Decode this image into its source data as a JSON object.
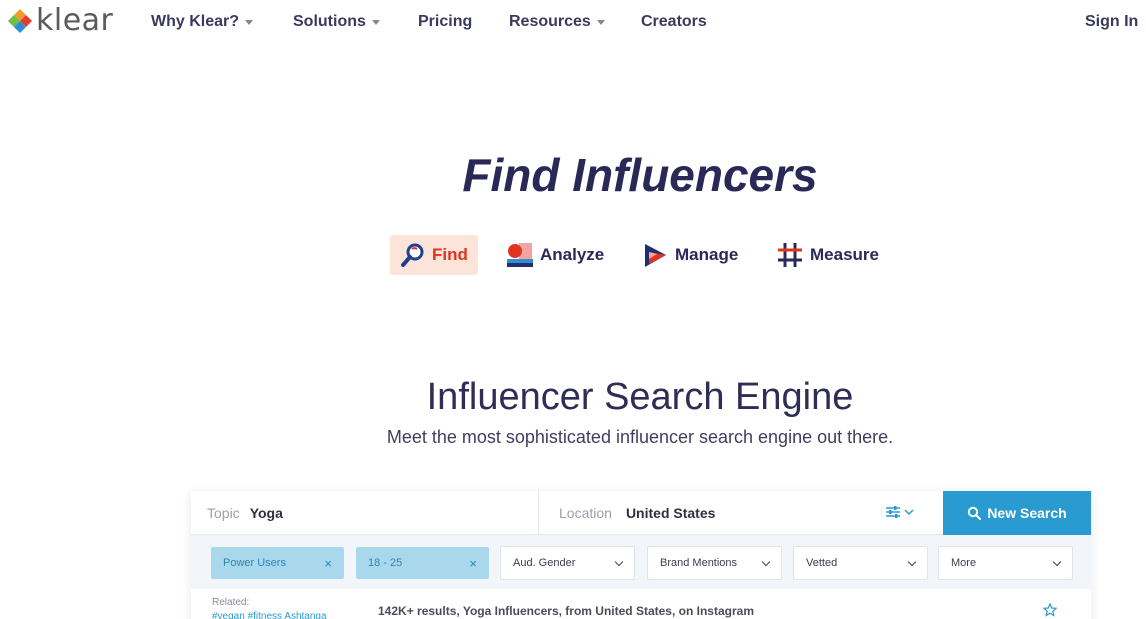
{
  "nav": {
    "logo_text": "klear",
    "items": [
      {
        "label": "Why Klear?",
        "has_caret": true
      },
      {
        "label": "Solutions",
        "has_caret": true
      },
      {
        "label": "Pricing",
        "has_caret": false
      },
      {
        "label": "Resources",
        "has_caret": true
      },
      {
        "label": "Creators",
        "has_caret": false
      }
    ],
    "sign_in": "Sign In"
  },
  "hero": {
    "title": "Find Influencers",
    "tabs": [
      {
        "label": "Find",
        "icon": "magnifier-icon",
        "active": true
      },
      {
        "label": "Analyze",
        "icon": "analyze-icon",
        "active": false
      },
      {
        "label": "Manage",
        "icon": "manage-icon",
        "active": false
      },
      {
        "label": "Measure",
        "icon": "hashtag-icon",
        "active": false
      }
    ]
  },
  "section": {
    "title": "Influencer Search Engine",
    "subtitle": "Meet the most sophisticated influencer search engine out there."
  },
  "search": {
    "topic_label": "Topic",
    "topic_value": "Yoga",
    "location_label": "Location",
    "location_value": "United States",
    "button_label": "New Search",
    "chips": [
      {
        "label": "Power Users",
        "remove": "×"
      },
      {
        "label": "18 - 25",
        "remove": "×"
      }
    ],
    "dropdowns": [
      {
        "label": "Aud. Gender"
      },
      {
        "label": "Brand Mentions"
      },
      {
        "label": "Vetted"
      },
      {
        "label": "More"
      }
    ],
    "related_label": "Related:",
    "related_tags": "#vegan   #fitness   Ashtanga",
    "results_summary": "142K+ results, Yoga Influencers, from United States, on Instagram"
  },
  "colors": {
    "brand_navy": "#2a2857",
    "accent_blue": "#2a9bd0",
    "find_active_bg": "#fde4da",
    "find_active_text": "#e0341f",
    "chip_bg": "#a9d8ec"
  }
}
